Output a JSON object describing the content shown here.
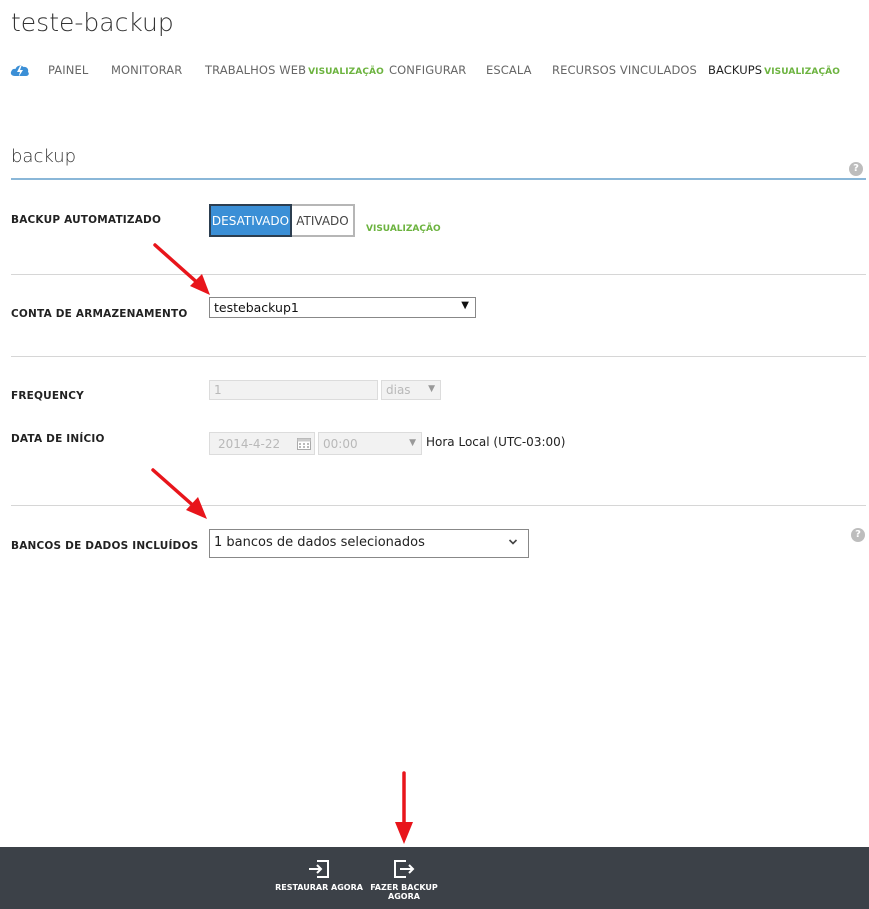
{
  "app": {
    "title": "teste-backup"
  },
  "nav": {
    "items": [
      {
        "label": "PAINEL",
        "preview": ""
      },
      {
        "label": "MONITORAR",
        "preview": ""
      },
      {
        "label": "TRABALHOS WEB",
        "preview": "VISUALIZAÇÃO"
      },
      {
        "label": "CONFIGURAR",
        "preview": ""
      },
      {
        "label": "ESCALA",
        "preview": ""
      },
      {
        "label": "RECURSOS VINCULADOS",
        "preview": ""
      },
      {
        "label": "BACKUPS",
        "preview": "VISUALIZAÇÃO"
      }
    ],
    "active_index": 6,
    "logo_icon": "lightning-cloud-icon"
  },
  "section": {
    "title": "backup",
    "help_icon": "question-icon"
  },
  "form": {
    "auto_backup": {
      "label": "BACKUP AUTOMATIZADO",
      "off_label": "DESATIVADO",
      "on_label": "ATIVADO",
      "selected": "DESATIVADO",
      "preview": "VISUALIZAÇÃO"
    },
    "storage": {
      "label": "CONTA DE ARMAZENAMENTO",
      "value": "testebackup1"
    },
    "frequency": {
      "label": "FREQUENCY",
      "value": "1",
      "unit": "dias"
    },
    "start_date": {
      "label": "DATA DE INÍCIO",
      "date": "2014-4-22",
      "time": "00:00",
      "timezone": "Hora Local (UTC-03:00)"
    },
    "databases": {
      "label": "BANCOS DE DADOS INCLUÍDOS",
      "value": "1 bancos de dados selecionados"
    }
  },
  "commands": {
    "restore": "RESTAURAR AGORA",
    "backup_line1": "FAZER BACKUP",
    "backup_line2": "AGORA"
  },
  "colors": {
    "accent_blue": "#3b8fd6",
    "preview_green": "#6cb33f",
    "command_bar": "#3c4148",
    "annotation_arrow": "#e8151b"
  }
}
